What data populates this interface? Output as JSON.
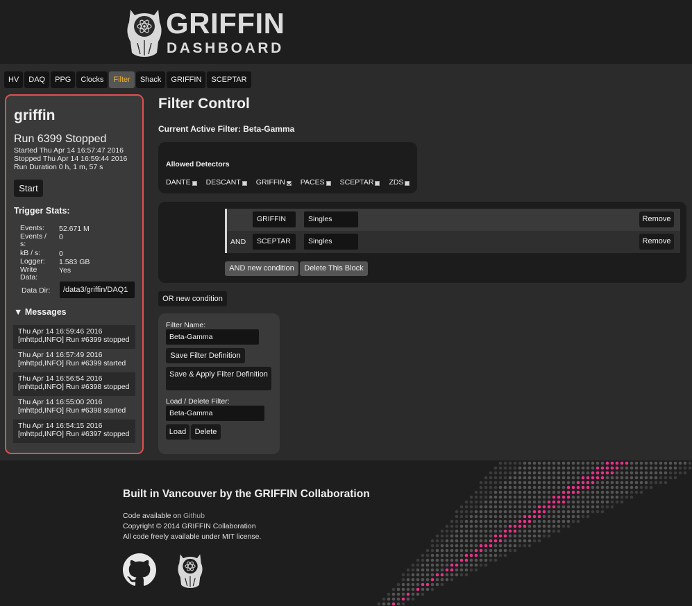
{
  "header": {
    "logo_title": "GRIFFIN",
    "logo_subtitle": "DASHBOARD"
  },
  "nav": {
    "tabs": [
      {
        "label": "HV",
        "active": false
      },
      {
        "label": "DAQ",
        "active": false
      },
      {
        "label": "PPG",
        "active": false
      },
      {
        "label": "Clocks",
        "active": false
      },
      {
        "label": "Filter",
        "active": true
      },
      {
        "label": "Shack",
        "active": false
      },
      {
        "label": "GRIFFIN",
        "active": false
      },
      {
        "label": "SCEPTAR",
        "active": false
      }
    ]
  },
  "sidebar": {
    "experiment": "griffin",
    "run_status": "Run 6399 Stopped",
    "started": "Started Thu Apr 14 16:57:47 2016",
    "stopped": "Stopped Thu Apr 14 16:59:44 2016",
    "duration": "Run Duration 0 h, 1 m, 57 s",
    "start_button": "Start",
    "trigger_title": "Trigger Stats:",
    "stats": [
      {
        "label": "Events:",
        "value": "52.671 M"
      },
      {
        "label": "Events / s:",
        "value": "0"
      },
      {
        "label": "kB / s:",
        "value": "0"
      },
      {
        "label": "Logger:",
        "value": "1.583 GB"
      },
      {
        "label": "Write Data:",
        "value": "Yes"
      }
    ],
    "data_dir_label": "Data Dir:",
    "data_dir_value": "/data3/griffin/DAQ1",
    "messages_title": "▼ Messages",
    "messages": [
      {
        "time": "Thu Apr 14 16:59:46 2016",
        "text": "[mhttpd,INFO] Run #6399 stopped"
      },
      {
        "time": "Thu Apr 14 16:57:49 2016",
        "text": "[mhttpd,INFO] Run #6399 started"
      },
      {
        "time": "Thu Apr 14 16:56:54 2016",
        "text": "[mhttpd,INFO] Run #6398 stopped"
      },
      {
        "time": "Thu Apr 14 16:55:00 2016",
        "text": "[mhttpd,INFO] Run #6398 started"
      },
      {
        "time": "Thu Apr 14 16:54:15 2016",
        "text": "[mhttpd,INFO] Run #6397 stopped"
      }
    ]
  },
  "main": {
    "title": "Filter Control",
    "current_filter_label": "Current Active Filter:",
    "current_filter_value": "Beta-Gamma",
    "detectors_title": "Allowed Detectors",
    "detectors": [
      {
        "name": "DANTE",
        "checked": false
      },
      {
        "name": "DESCANT",
        "checked": false
      },
      {
        "name": "GRIFFIN",
        "checked": true
      },
      {
        "name": "PACES",
        "checked": false
      },
      {
        "name": "SCEPTAR",
        "checked": false
      },
      {
        "name": "ZDS",
        "checked": false
      }
    ],
    "conditions": [
      {
        "op": "",
        "detector": "GRIFFIN",
        "type": "Singles",
        "remove": "Remove"
      },
      {
        "op": "AND",
        "detector": "SCEPTAR",
        "type": "Singles",
        "remove": "Remove"
      }
    ],
    "and_new_condition": "AND new condition",
    "delete_block": "Delete This Block",
    "or_new_condition": "OR new condition",
    "filter_name_label": "Filter Name:",
    "filter_name_value": "Beta-Gamma",
    "save_definition": "Save Filter Definition",
    "save_apply": "Save & Apply Filter Definition",
    "load_delete_label": "Load / Delete Filter:",
    "load_value": "Beta-Gamma",
    "load_button": "Load",
    "delete_button": "Delete"
  },
  "footer": {
    "title": "Built in Vancouver by the GRIFFIN Collaboration",
    "code_available_prefix": "Code available on",
    "github_link": "Github",
    "copyright": "Copyright © 2014 GRIFFIN Collaboration",
    "license": "All code freely available under MIT license."
  },
  "colors": {
    "accent_active_tab": "#f0b030",
    "sidebar_border": "#e05050",
    "art_pink": "#e8328a"
  },
  "icons": [
    "owl-logo-icon",
    "atom-icon",
    "github-icon",
    "checkbox-icon"
  ]
}
